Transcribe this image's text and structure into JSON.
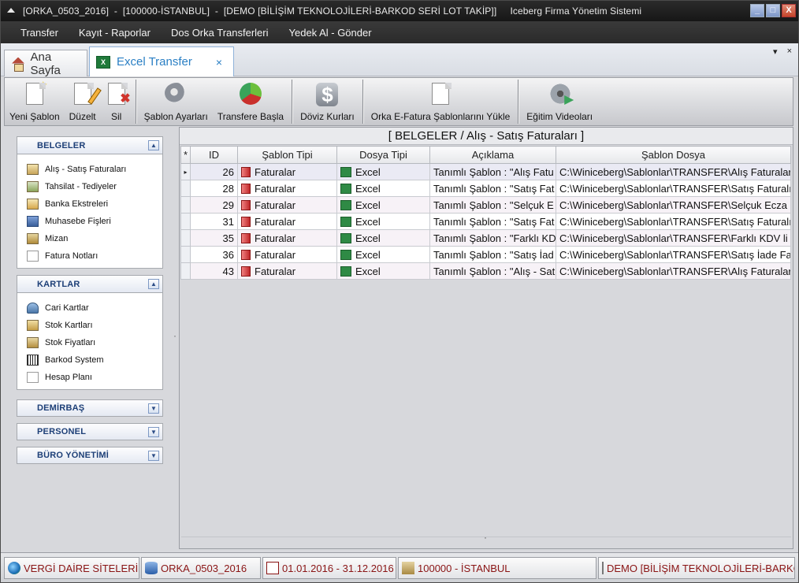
{
  "titlebar": {
    "text": "[ORKA_0503_2016]  -  [100000-İSTANBUL]  -  [DEMO [BİLİŞİM TEKNOLOJİLERİ-BARKOD SERİ LOT TAKİP]]     Iceberg Firma Yönetim Sistemi",
    "buttons": [
      "_",
      "□",
      "X"
    ]
  },
  "menu": [
    "Transfer",
    "Kayıt - Raporlar",
    "Dos Orka Transferleri",
    "Yedek Al - Gönder"
  ],
  "tabs": {
    "home": "Ana Sayfa",
    "active": "Excel Transfer",
    "close": "×",
    "strip_dropdown": "▾",
    "strip_close": "×",
    "xls_glyph": "X"
  },
  "toolbar": {
    "new": "Yeni Şablon",
    "edit": "Düzelt",
    "delete": "Sil",
    "template_settings": "Şablon Ayarları",
    "start_transfer": "Transfere Başla",
    "currency_rates": "Döviz Kurları",
    "load_efatura": "Orka E-Fatura Şablonlarını Yükle",
    "training_videos": "Eğitim Videoları",
    "dollar_glyph": "$",
    "x_glyph": "✖"
  },
  "sidebar": {
    "groups": [
      {
        "title": "BELGELER",
        "toggle": "▲",
        "items": [
          "Alış - Satış Faturaları",
          "Tahsilat - Tediyeler",
          "Banka Ekstreleri",
          "Muhasebe Fişleri",
          "Mizan",
          "Fatura Notları"
        ]
      },
      {
        "title": "KARTLAR",
        "toggle": "▲",
        "items": [
          "Cari Kartlar",
          "Stok Kartları",
          "Stok Fiyatları",
          "Barkod System",
          "Hesap Planı"
        ]
      },
      {
        "title": "DEMİRBAŞ",
        "toggle": "▼"
      },
      {
        "title": "PERSONEL",
        "toggle": "▼"
      },
      {
        "title": "BÜRO YÖNETİMİ",
        "toggle": "▼"
      }
    ]
  },
  "content": {
    "title": "[ BELGELER / Alış - Satış Faturaları ]",
    "new_row_marker": "*",
    "current_row_marker": "▸",
    "columns": [
      "ID",
      "Şablon Tipi",
      "Dosya Tipi",
      "Açıklama",
      "Şablon Dosya"
    ],
    "rows": [
      {
        "id": "26",
        "type": "Faturalar",
        "file_type": "Excel",
        "desc": "Tanımlı Şablon : \"Alış Fatu",
        "path": "C:\\Winiceberg\\Sablonlar\\TRANSFER\\Alış Faturaları"
      },
      {
        "id": "28",
        "type": "Faturalar",
        "file_type": "Excel",
        "desc": "Tanımlı Şablon : \"Satış Fat",
        "path": "C:\\Winiceberg\\Sablonlar\\TRANSFER\\Satış Faturalı"
      },
      {
        "id": "29",
        "type": "Faturalar",
        "file_type": "Excel",
        "desc": "Tanımlı Şablon : \"Selçuk E",
        "path": "C:\\Winiceberg\\Sablonlar\\TRANSFER\\Selçuk Ecza"
      },
      {
        "id": "31",
        "type": "Faturalar",
        "file_type": "Excel",
        "desc": "Tanımlı Şablon : \"Satış Fat",
        "path": "C:\\Winiceberg\\Sablonlar\\TRANSFER\\Satış Faturalı"
      },
      {
        "id": "35",
        "type": "Faturalar",
        "file_type": "Excel",
        "desc": "Tanımlı Şablon : \"Farklı KD",
        "path": "C:\\Winiceberg\\Sablonlar\\TRANSFER\\Farklı KDV li"
      },
      {
        "id": "36",
        "type": "Faturalar",
        "file_type": "Excel",
        "desc": "Tanımlı Şablon : \"Satış İad",
        "path": "C:\\Winiceberg\\Sablonlar\\TRANSFER\\Satış İade Fa"
      },
      {
        "id": "43",
        "type": "Faturalar",
        "file_type": "Excel",
        "desc": "Tanımlı Şablon : \"Alış - Sat",
        "path": "C:\\Winiceberg\\Sablonlar\\TRANSFER\\Alış Faturalar"
      }
    ]
  },
  "statusbar": {
    "tax_offices": "VERGİ DAİRE SİTELERİ",
    "database": "ORKA_0503_2016",
    "period": "01.01.2016 - 31.12.2016",
    "branch": "100000 - İSTANBUL",
    "company": "DEMO [BİLİŞİM TEKNOLOJİLERİ-BARKOD SERİ LOT TAKİP]"
  }
}
